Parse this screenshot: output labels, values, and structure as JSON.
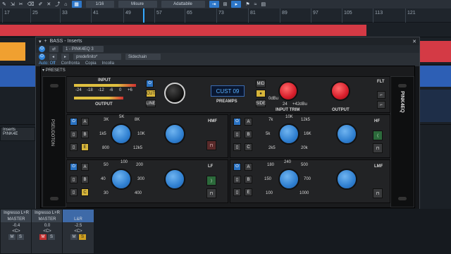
{
  "toolbar": {
    "snap": "1/16",
    "mode": "Misure",
    "quantize": "Adattabile"
  },
  "ruler": {
    "ticks": [
      "17",
      "25",
      "33",
      "41",
      "49",
      "57",
      "65",
      "73",
      "81",
      "89",
      "97",
      "105",
      "113",
      "121"
    ]
  },
  "insert_window": {
    "title": "BASS - Inserts",
    "slot": "1 - PINK4EQ 3",
    "preset": "predefinito*",
    "sidechain": "Sidechain",
    "auto": "Auto: Off",
    "compare": "Confronta",
    "copy": "Copia",
    "paste": "Incolla"
  },
  "plugin": {
    "presets": "PRESETS",
    "brand": "PINK4EQ",
    "maker": "PSEUDOTON",
    "input": "INPUT",
    "output_meter": "OUTPUT",
    "meter_scale": [
      "-24",
      "-18",
      "-12",
      "-6",
      "0",
      "+6"
    ],
    "display": "CUST 09",
    "preamps": "PREAMPS",
    "cut": "CUT",
    "line": "LINE",
    "mid": "MID",
    "side": "SIDE",
    "input_trim": "INPUT TRIM",
    "output": "OUTPUT",
    "flt": "FLT",
    "trim_scale": [
      "0dBu",
      "24",
      "+42dBu"
    ],
    "hmf": "HMF",
    "hf": "HF",
    "lf": "LF",
    "lmf": "LMF",
    "abcde": [
      "A",
      "B",
      "C",
      "D",
      "E"
    ],
    "hmf_freq": [
      "3K",
      "5K",
      "8K",
      "1k5",
      "10K",
      "800",
      "12k5"
    ],
    "hf_freq": [
      "7k",
      "10K",
      "12k5",
      "5k",
      "16K",
      "2k5",
      "20k"
    ],
    "lf_freq": [
      "50",
      "100",
      "200",
      "40",
      "300",
      "30",
      "400"
    ],
    "lmf_freq": [
      "180",
      "240",
      "500",
      "150",
      "700",
      "100",
      "1000"
    ],
    "gain_scale": [
      "2",
      "0",
      "2",
      "4",
      "4",
      "6",
      "6",
      "8",
      "8",
      "10",
      "10",
      "12",
      "12"
    ],
    "trim_nums": [
      "6",
      "8",
      "4",
      "10",
      "2",
      "12",
      "0",
      "14"
    ]
  },
  "tracks": {
    "insert_label": "Inserts",
    "insert_item": "PINK4E"
  },
  "mixer": {
    "channels": [
      {
        "name": "Ingresso L+R",
        "bus": "MASTER",
        "value": "-0.4",
        "pan": "<C>"
      },
      {
        "name": "Ingresso L+R",
        "bus": "MASTER",
        "value": "0.0",
        "pan": "<C>"
      },
      {
        "name": "",
        "bus": "L&R",
        "value": "-2.5",
        "pan": "<C>"
      }
    ],
    "m": "M",
    "s": "S"
  },
  "colors": {
    "accent": "#2e84dc",
    "clip_red": "#d43a45",
    "clip_orange": "#f0a030",
    "knob_red": "#d61d2a",
    "knob_blue": "#2f7fd0",
    "button_yellow": "#d7b53a"
  }
}
